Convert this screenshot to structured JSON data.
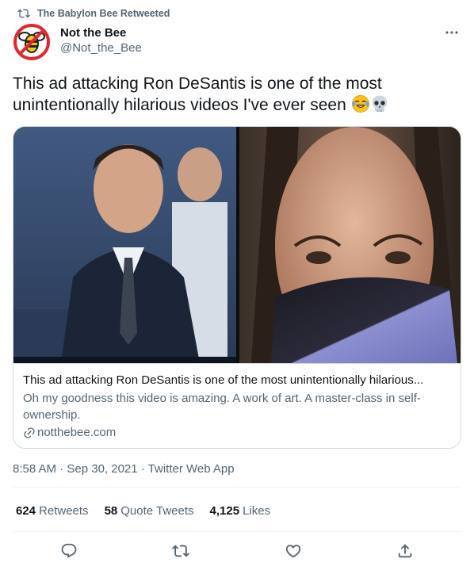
{
  "retweet_header": {
    "text": "The Babylon Bee Retweeted",
    "icon": "retweet-icon"
  },
  "author": {
    "display_name": "Not the Bee",
    "handle": "@Not_the_Bee",
    "avatar": "not-the-bee-logo"
  },
  "tweet": {
    "text": "This ad attacking Ron DeSantis is one of the most unintentionally hilarious videos I've ever seen",
    "emojis": [
      "face-with-tears-of-joy",
      "skull"
    ]
  },
  "card": {
    "image": "split photo: man in suit at podium / woman wearing face mask",
    "title": "This ad attacking Ron DeSantis is one of the most unintentionally hilarious...",
    "description": "Oh my goodness this video is amazing. A work of art. A master-class in self-ownership.",
    "domain": "notthebee.com"
  },
  "meta": {
    "timestamp": "8:58 AM · Sep 30, 2021 · Twitter Web App"
  },
  "stats": [
    {
      "num": "624",
      "label": "Retweets"
    },
    {
      "num": "58",
      "label": "Quote Tweets"
    },
    {
      "num": "4,125",
      "label": "Likes"
    }
  ],
  "actions": [
    "reply-icon",
    "retweet-icon",
    "like-icon",
    "share-icon"
  ],
  "colors": {
    "text": "#0f1419",
    "secondary": "#536471",
    "border": "#cfd9de",
    "divider": "#eff3f4",
    "logo_red": "#e0282e",
    "logo_yellow": "#f7c51e"
  }
}
